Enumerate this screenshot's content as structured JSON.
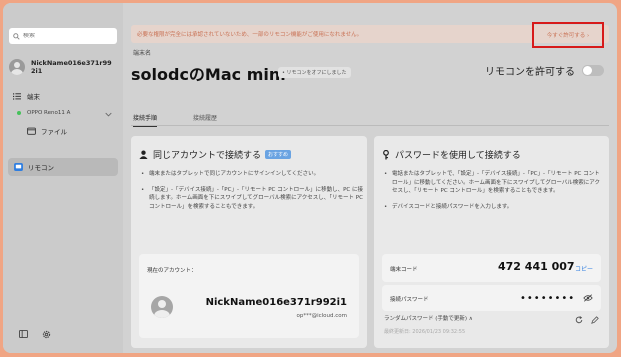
{
  "sidebar": {
    "search_placeholder": "検索",
    "account_name": "NickName016e371r992i1",
    "items": [
      {
        "label": "端末"
      },
      {
        "label": "OPPO Reno11 A"
      },
      {
        "label": "ファイル"
      },
      {
        "label": "リモコン"
      }
    ]
  },
  "banner": {
    "text": "必要な権限が完全には承認されていないため、一部のリモコン機能がご使用になれません。",
    "button": "今すぐ許可する ›"
  },
  "device": {
    "label": "端末名",
    "title": "solodcのMac mini",
    "badge": "• リモコンをオフにしました",
    "allow_label": "リモコンを許可する"
  },
  "tabs": [
    {
      "label": "接続手順"
    },
    {
      "label": "接続履歴"
    }
  ],
  "left_card": {
    "title": "同じアカウントで接続する",
    "badge": "おすすめ",
    "bullets": [
      "端末またはタブレットで同じアカウントにサインインしてください。",
      "「設定」-「デバイス接続」-「PC」-「リモート PC コントロール」に移動し、PC に接続します。ホーム画面を下にスワイプしてグローバル検索にアクセスし、「リモート PC コントロール」を検索することもできます。"
    ],
    "current_label": "現在のアカウント：",
    "nickname": "NickName016e371r992i1",
    "email": "op***@icloud.com"
  },
  "right_card": {
    "title": "パスワードを使用して接続する",
    "bullets": [
      "電話またはタブレットで、「設定」-「デバイス接続」-「PC」-「リモート PC コントロール」に移動してください。ホーム画面を下にスワイプしてグローバル検索にアクセスし、「リモート PC コントロール」を検索することもできます。",
      "デバイスコードと接続パスワードを入力します。"
    ],
    "code_label": "端末コード",
    "code_value": "472 441 007",
    "copy_label": "コピー",
    "password_label": "接続パスワード",
    "password_value": "••••••••",
    "random_label": "ランダムパスワード (手動で更新) ∧",
    "updated": "最終更新日: 2026/01/23 09:32:55"
  }
}
